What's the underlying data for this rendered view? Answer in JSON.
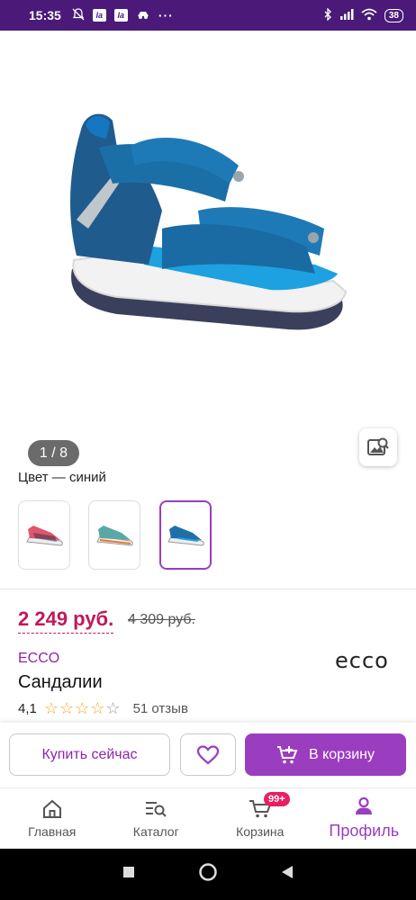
{
  "status_bar": {
    "time": "15:35",
    "app_icon_1": "la",
    "app_icon_2": "la",
    "more": "···",
    "battery": "38"
  },
  "gallery": {
    "counter": "1 / 8",
    "search_icon": "image-search-icon"
  },
  "color_section": {
    "label": "Цвет — синий",
    "swatches": [
      {
        "name": "pink-sandal",
        "color": "#e0566a"
      },
      {
        "name": "teal-sandal",
        "color": "#5aa7a7"
      },
      {
        "name": "blue-sandal",
        "color": "#1f6fa8",
        "selected": true
      }
    ]
  },
  "price": {
    "current": "2 249 руб.",
    "old": "4 309 руб."
  },
  "product": {
    "brand": "ECCO",
    "brand_logo": "ecco",
    "name": "Сандалии"
  },
  "rating": {
    "value": "4,1",
    "stars": 4,
    "reviews": "51 отзыв"
  },
  "actions": {
    "buy_now": "Купить сейчас",
    "add_to_cart": "В корзину"
  },
  "bottom_nav": {
    "home": "Главная",
    "catalog": "Каталог",
    "cart": "Корзина",
    "cart_badge": "99+",
    "profile": "Профиль"
  },
  "colors": {
    "accent": "#9b3dbf",
    "price": "#c2185b",
    "brand": "#8e24aa",
    "status_bar": "#4b1a78"
  }
}
